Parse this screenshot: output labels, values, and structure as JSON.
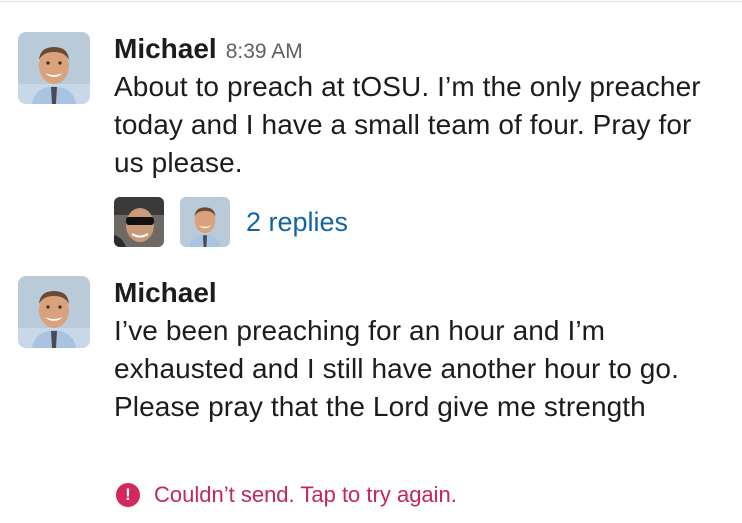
{
  "messages": [
    {
      "author": "Michael",
      "time": "8:39 AM",
      "text": "About to preach at tOSU. I’m the only preacher today and I have a small team of four. Pray for us please.",
      "thread": {
        "replies_label": "2 replies"
      }
    },
    {
      "author": "Michael",
      "text": "I’ve been preaching for an hour and I’m exhausted and I still have another hour to go. Please pray that the Lord give me strength",
      "error": {
        "icon": "alert-icon",
        "glyph": "!",
        "text": "Couldn’t send. Tap to try again."
      }
    }
  ],
  "colors": {
    "link": "#1264a3",
    "error": "#c4265a",
    "timestamp": "#616061"
  }
}
